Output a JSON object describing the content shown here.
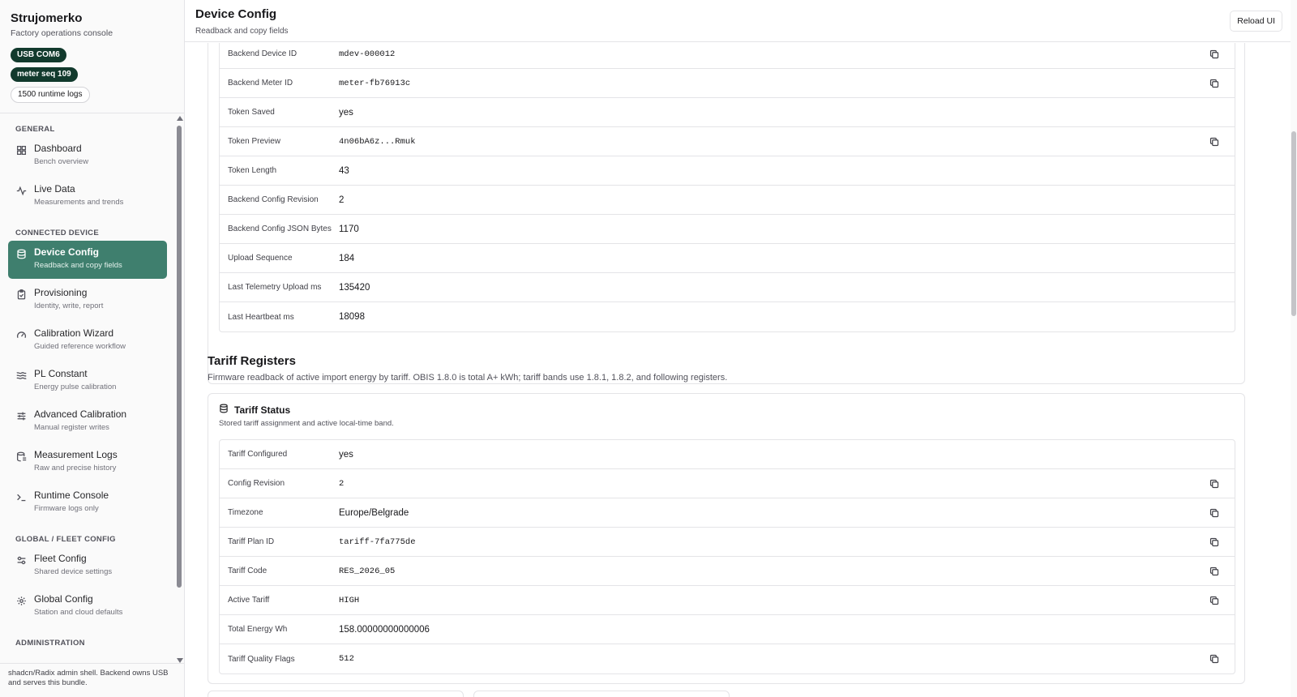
{
  "app": {
    "title": "Strujomerko",
    "subtitle": "Factory operations console",
    "badges": [
      "USB COM6",
      "meter seq 109",
      "1500 runtime logs"
    ],
    "footer": "shadcn/Radix admin shell. Backend owns USB and serves this bundle."
  },
  "nav": {
    "sections": [
      "GENERAL",
      "CONNECTED DEVICE",
      "GLOBAL / FLEET CONFIG",
      "ADMINISTRATION"
    ],
    "items": [
      {
        "label": "Dashboard",
        "desc": "Bench overview",
        "icon": "grid-icon"
      },
      {
        "label": "Live Data",
        "desc": "Measurements and trends",
        "icon": "activity-icon"
      },
      {
        "label": "Device Config",
        "desc": "Readback and copy fields",
        "icon": "database-icon",
        "active": true
      },
      {
        "label": "Provisioning",
        "desc": "Identity, write, report",
        "icon": "clipboard-icon"
      },
      {
        "label": "Calibration Wizard",
        "desc": "Guided reference workflow",
        "icon": "gauge-icon"
      },
      {
        "label": "PL Constant",
        "desc": "Energy pulse calibration",
        "icon": "waves-icon"
      },
      {
        "label": "Advanced Calibration",
        "desc": "Manual register writes",
        "icon": "sliders-icon"
      },
      {
        "label": "Measurement Logs",
        "desc": "Raw and precise history",
        "icon": "logs-icon"
      },
      {
        "label": "Runtime Console",
        "desc": "Firmware logs only",
        "icon": "terminal-icon"
      },
      {
        "label": "Fleet Config",
        "desc": "Shared device settings",
        "icon": "settings-sliders-icon"
      },
      {
        "label": "Global Config",
        "desc": "Station and cloud defaults",
        "icon": "gear-icon"
      }
    ]
  },
  "header": {
    "title": "Device Config",
    "subtitle": "Readback and copy fields",
    "reload_label": "Reload UI"
  },
  "backend": {
    "rows": [
      {
        "key": "Backend Device ID",
        "value": "mdev-000012",
        "mono": true,
        "copy": true
      },
      {
        "key": "Backend Meter ID",
        "value": "meter-fb76913c",
        "mono": true,
        "copy": true
      },
      {
        "key": "Token Saved",
        "value": "yes",
        "mono": false,
        "copy": false
      },
      {
        "key": "Token Preview",
        "value": "4n06bA6z...Rmuk",
        "mono": true,
        "copy": true
      },
      {
        "key": "Token Length",
        "value": "43",
        "mono": false,
        "copy": false
      },
      {
        "key": "Backend Config Revision",
        "value": "2",
        "mono": false,
        "copy": false
      },
      {
        "key": "Backend Config JSON Bytes",
        "value": "1170",
        "mono": false,
        "copy": false
      },
      {
        "key": "Upload Sequence",
        "value": "184",
        "mono": false,
        "copy": false
      },
      {
        "key": "Last Telemetry Upload ms",
        "value": "135420",
        "mono": false,
        "copy": false
      },
      {
        "key": "Last Heartbeat ms",
        "value": "18098",
        "mono": false,
        "copy": false
      }
    ]
  },
  "tariff": {
    "section_title": "Tariff Registers",
    "section_desc": "Firmware readback of active import energy by tariff. OBIS 1.8.0 is total A+ kWh; tariff bands use 1.8.1, 1.8.2, and following registers.",
    "card_title": "Tariff Status",
    "card_desc": "Stored tariff assignment and active local-time band.",
    "rows": [
      {
        "key": "Tariff Configured",
        "value": "yes",
        "mono": false,
        "copy": false
      },
      {
        "key": "Config Revision",
        "value": "2",
        "mono": true,
        "copy": true
      },
      {
        "key": "Timezone",
        "value": "Europe/Belgrade",
        "mono": false,
        "copy": true
      },
      {
        "key": "Tariff Plan ID",
        "value": "tariff-7fa775de",
        "mono": true,
        "copy": true
      },
      {
        "key": "Tariff Code",
        "value": "RES_2026_05",
        "mono": true,
        "copy": true
      },
      {
        "key": "Active Tariff",
        "value": "HIGH",
        "mono": true,
        "copy": true
      },
      {
        "key": "Total Energy Wh",
        "value": "158.00000000000006",
        "mono": false,
        "copy": false
      },
      {
        "key": "Tariff Quality Flags",
        "value": "512",
        "mono": true,
        "copy": true
      }
    ]
  }
}
